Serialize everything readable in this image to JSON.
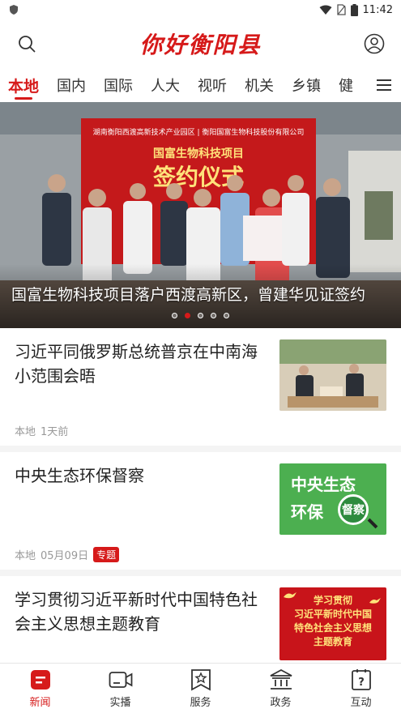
{
  "status_bar": {
    "time": "11:42"
  },
  "header": {
    "logo_text": "你好衡阳县",
    "search_icon": "search-icon",
    "profile_icon": "user-icon"
  },
  "tabs": [
    {
      "label": "本地",
      "active": true
    },
    {
      "label": "国内"
    },
    {
      "label": "国际"
    },
    {
      "label": "人大"
    },
    {
      "label": "视听"
    },
    {
      "label": "机关"
    },
    {
      "label": "乡镇"
    },
    {
      "label": "健"
    }
  ],
  "banner": {
    "caption": "国富生物科技项目落户西渡高新区，曾建华见证签约",
    "backdrop_line1": "湖南衡阳西渡高新技术产业园区 | 衡阳国富生物科技股份有限公司",
    "backdrop_line2": "国富生物科技项目",
    "backdrop_line3": "签约仪式",
    "dots": 5,
    "active_dot": 1
  },
  "news": [
    {
      "title": "习近平同俄罗斯总统普京在中南海小范围会晤",
      "source": "本地",
      "time": "1天前",
      "tag": ""
    },
    {
      "title": "中央生态环保督察",
      "source": "本地",
      "time": "05月09日",
      "tag": "专题",
      "thumb_line1": "中央生态",
      "thumb_line2": "环保",
      "thumb_badge": "督察"
    },
    {
      "title": "学习贯彻习近平新时代中国特色社会主义思想主题教育",
      "source": "",
      "time": "",
      "tag": "",
      "thumb_line1": "学习贯彻",
      "thumb_line2": "习近平新时代中国",
      "thumb_line3": "特色社会主义思想",
      "thumb_line4": "主题教育"
    }
  ],
  "bottom_nav": [
    {
      "label": "新闻",
      "icon": "news-icon",
      "active": true
    },
    {
      "label": "实播",
      "icon": "camera-icon"
    },
    {
      "label": "服务",
      "icon": "service-icon"
    },
    {
      "label": "政务",
      "icon": "government-icon"
    },
    {
      "label": "互动",
      "icon": "question-icon"
    }
  ],
  "colors": {
    "brand_red": "#d61a1a",
    "green_thumb": "#4caf50"
  }
}
